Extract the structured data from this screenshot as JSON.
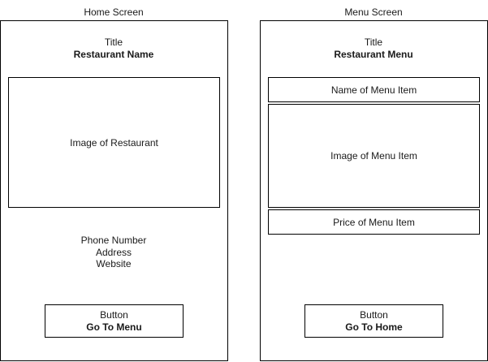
{
  "home": {
    "label": "Home Screen",
    "title_caption": "Title",
    "title_value": "Restaurant Name",
    "image_text": "Image of Restaurant",
    "contact": [
      "Phone Number",
      "Address",
      "Website"
    ],
    "button_caption": "Button",
    "button_label": "Go To Menu"
  },
  "menu": {
    "label": "Menu Screen",
    "title_caption": "Title",
    "title_value": "Restaurant Menu",
    "item_name_text": "Name of Menu Item",
    "item_image_text": "Image of Menu Item",
    "item_price_text": "Price of Menu Item",
    "button_caption": "Button",
    "button_label": "Go To Home"
  }
}
